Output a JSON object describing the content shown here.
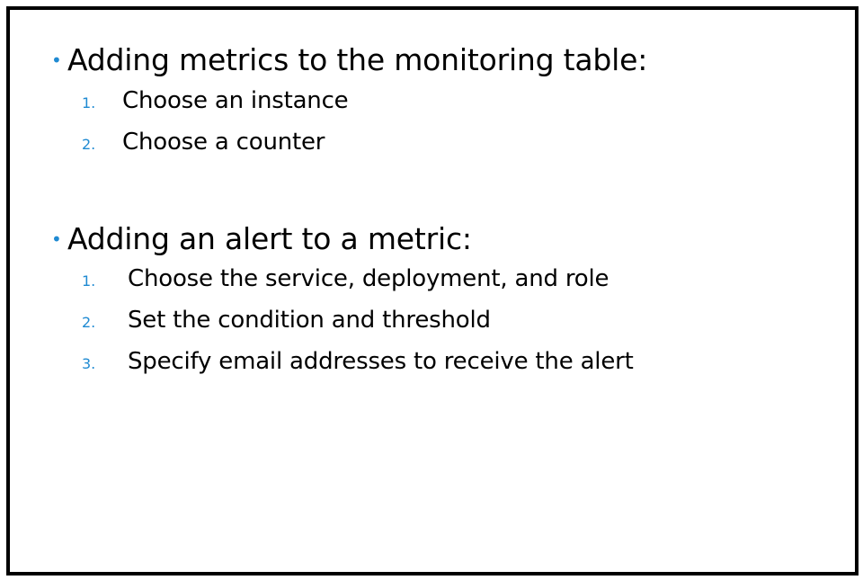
{
  "sections": [
    {
      "heading": "Adding metrics to the monitoring table:",
      "items": [
        {
          "number": "1.",
          "text": "Choose an instance"
        },
        {
          "number": "2.",
          "text": "Choose a counter"
        }
      ]
    },
    {
      "heading": "Adding an alert to a metric:",
      "items": [
        {
          "number": "1.",
          "text": "Choose the service, deployment, and role"
        },
        {
          "number": "2.",
          "text": "Set the condition and threshold"
        },
        {
          "number": "3.",
          "text": "Specify email addresses to receive the alert"
        }
      ]
    }
  ],
  "colors": {
    "accent": "#1f8ad2",
    "text": "#000000",
    "border": "#000000",
    "background": "#ffffff"
  }
}
